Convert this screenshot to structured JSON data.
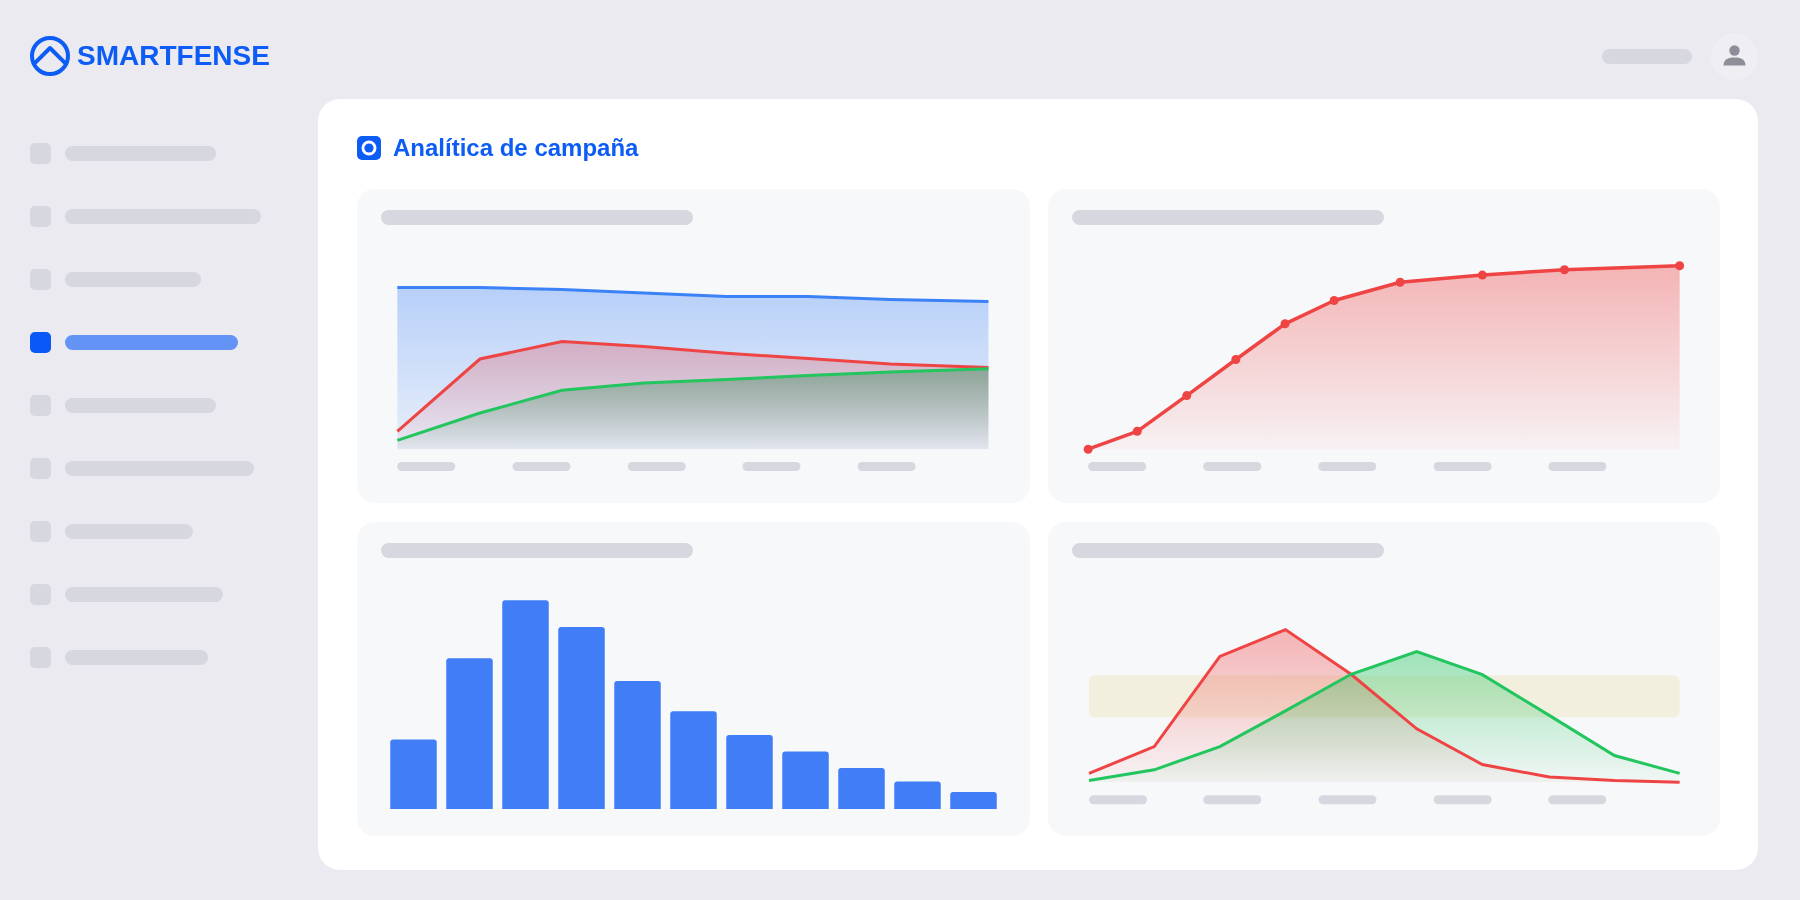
{
  "brand": {
    "name": "SMARTFENSE"
  },
  "sidebar": {
    "items": [
      {
        "selected": false
      },
      {
        "selected": false
      },
      {
        "selected": false
      },
      {
        "selected": true
      },
      {
        "selected": false
      },
      {
        "selected": false
      },
      {
        "selected": false
      },
      {
        "selected": false
      },
      {
        "selected": false
      }
    ]
  },
  "main": {
    "title": "Analítica de campaña",
    "panels": [
      {
        "kind": "area"
      },
      {
        "kind": "line"
      },
      {
        "kind": "bar"
      },
      {
        "kind": "overlap"
      }
    ]
  }
}
